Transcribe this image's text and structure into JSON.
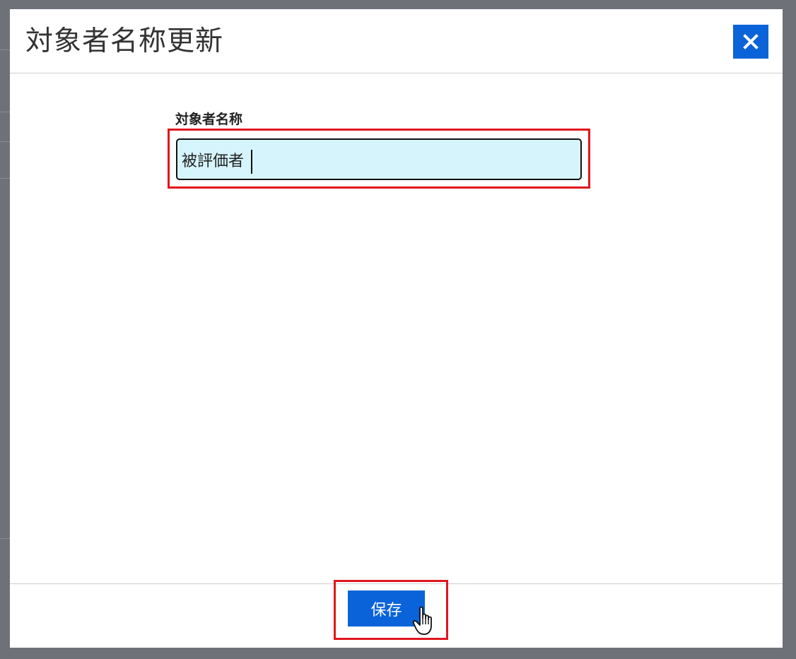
{
  "dialog": {
    "title": "対象者名称更新",
    "close_icon": "close-icon"
  },
  "form": {
    "field_label": "対象者名称",
    "field_value": "被評価者"
  },
  "footer": {
    "save_label": "保存"
  },
  "colors": {
    "accent": "#0a63d8",
    "highlight": "#e0161e",
    "input_background": "#d6f4fc",
    "overlay": "#6e7178"
  }
}
